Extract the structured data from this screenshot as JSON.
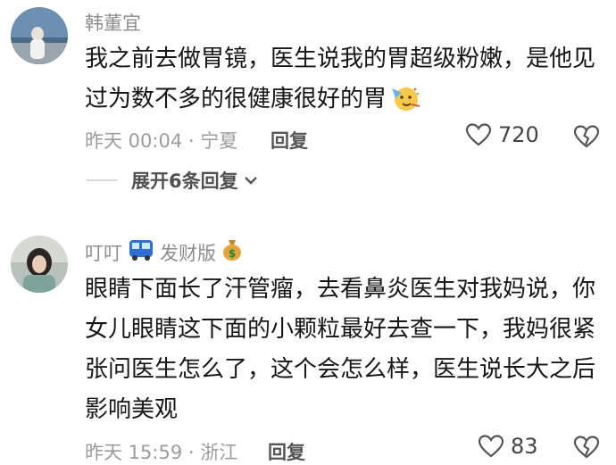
{
  "comments": [
    {
      "username": "韩董宜",
      "text": "我之前去做胃镜，医生说我的胃超级粉嫩，是他见过为数不多的很健康很好的胃",
      "time": "昨天 00:04",
      "location": "宁夏",
      "reply_label": "回复",
      "likes": "720",
      "emoji": "partying-face-emoji"
    },
    {
      "username": "叮叮",
      "badge_label": "发财版",
      "text": "眼睛下面长了汗管瘤，去看鼻炎医生对我妈说，你女儿眼睛这下面的小颗粒最好去查一下，我妈很紧张问医生怎么了，这个会怎么样，医生说长大之后影响美观",
      "time": "昨天 15:59",
      "location": "浙江",
      "reply_label": "回复",
      "likes": "83"
    }
  ],
  "expand": {
    "label": "展开6条回复"
  },
  "icons": {
    "like": "heart-outline-icon",
    "dislike": "broken-heart-icon",
    "expand": "chevron-down-icon",
    "bus_badge": "bus-icon",
    "money_badge": "money-bag-icon"
  },
  "colors": {
    "username": "#8d8d8d",
    "meta": "#9c9c9c",
    "text": "#161616"
  }
}
